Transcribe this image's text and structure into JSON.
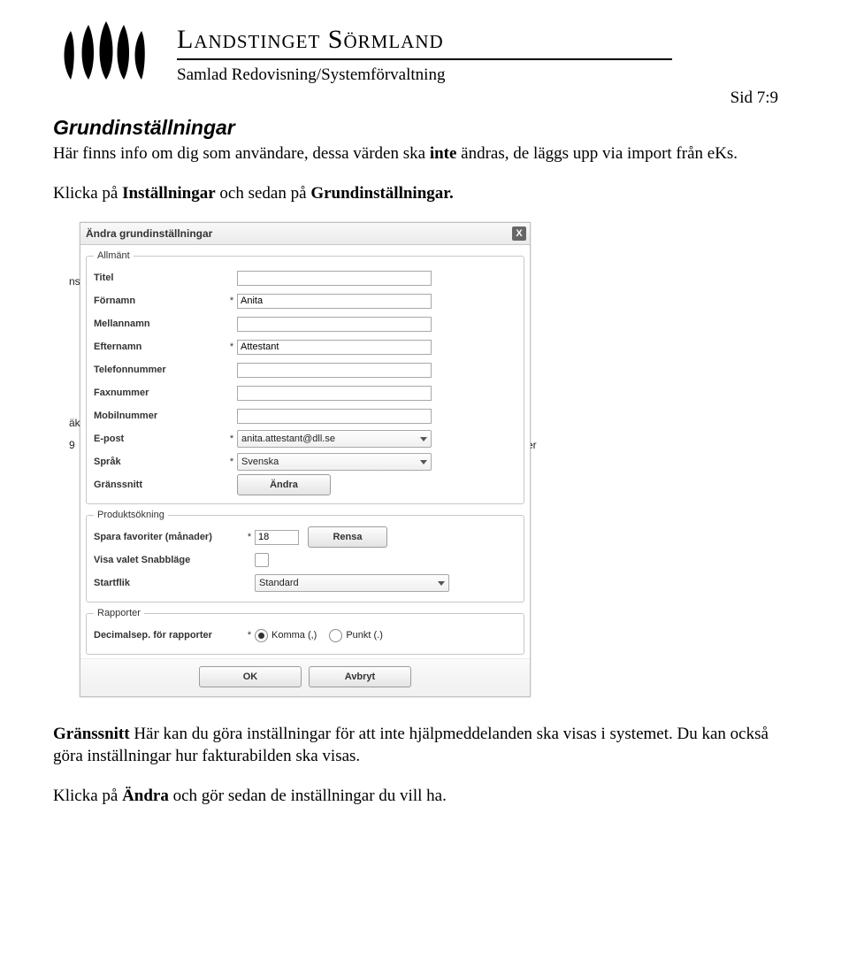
{
  "header": {
    "org_name": "Landstinget Sörmland",
    "subheader": "Samlad Redovisning/Systemförvaltning",
    "page_no": "Sid 7:9"
  },
  "body": {
    "heading": "Grundinställningar",
    "p1a": "Här finns info om dig som användare, dessa värden ska ",
    "p1b": "inte",
    "p1c": " ändras, de läggs upp via import från eKs.",
    "p2a": "Klicka på ",
    "p2b": "Inställningar",
    "p2c": " och sedan på ",
    "p2d": "Grundinställningar.",
    "p3a": "Gränssnitt",
    "p3b": " Här kan du göra inställningar för att inte hjälpmeddelanden ska visas i systemet. Du kan också göra inställningar hur fakturabilden ska visas.",
    "p4a": "Klicka på ",
    "p4b": "Ändra",
    "p4c": " och gör sedan de inställningar du vill ha."
  },
  "dialog": {
    "title": "Ändra grundinställningar",
    "close": "X",
    "groups": {
      "allmant": {
        "legend": "Allmänt",
        "fields": {
          "titel_label": "Titel",
          "fornamn_label": "Förnamn",
          "fornamn_value": "Anita",
          "mellannamn_label": "Mellannamn",
          "efternamn_label": "Efternamn",
          "efternamn_value": "Attestant",
          "telefon_label": "Telefonnummer",
          "fax_label": "Faxnummer",
          "mobil_label": "Mobilnummer",
          "epost_label": "E-post",
          "epost_value": "anita.attestant@dll.se",
          "sprak_label": "Språk",
          "sprak_value": "Svenska",
          "granssnitt_label": "Gränssnitt",
          "andra_btn": "Ändra"
        }
      },
      "produktsokning": {
        "legend": "Produktsökning",
        "fields": {
          "spara_label": "Spara favoriter (månader)",
          "spara_value": "18",
          "rensa_btn": "Rensa",
          "snabblage_label": "Visa valet Snabbläge",
          "startflik_label": "Startflik",
          "startflik_value": "Standard"
        }
      },
      "rapporter": {
        "legend": "Rapporter",
        "fields": {
          "decimalsep_label": "Decimalsep. för rapporter",
          "komma_label": "Komma (,)",
          "punkt_label": "Punkt (.)"
        }
      }
    },
    "buttons": {
      "ok": "OK",
      "avbryt": "Avbryt"
    }
  },
  "fragments": {
    "ns": "ns",
    "ak": "äk",
    "num": " 9",
    "er": "er"
  }
}
